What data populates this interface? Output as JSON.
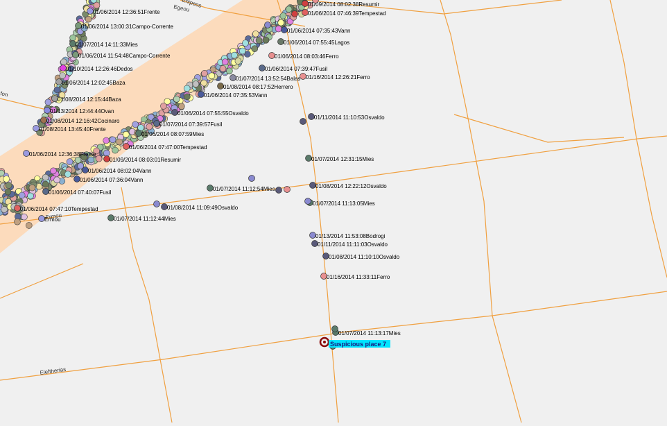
{
  "map": {
    "background": "#f0f0f0",
    "road_color": "#f0a040",
    "corridor_color": "#fcd9b8",
    "label_color": "#000000",
    "highlight_color": "#00e5ff",
    "roads": [
      {
        "name": "Xyfion",
        "label": "fon"
      },
      {
        "name": "Egeou",
        "label": "Egeou"
      },
      {
        "name": "Eleftherias",
        "label": "Eleftherias"
      },
      {
        "name": "Ermou",
        "label": "Ermou"
      },
      {
        "name": "Enipeos",
        "label": "Enipeos"
      }
    ],
    "events": [
      {
        "label": "01/09/2014 08:02:38Resumir",
        "color": "#d04040"
      },
      {
        "label": "01/06/2014 07:46:39Tempestad",
        "color": "#e06060"
      },
      {
        "label": "01/06/2014 07:35:43Vann",
        "color": "#4a5a9a"
      },
      {
        "label": "01/06/2014 07:55:45Lagos",
        "color": "#6a7a6a"
      },
      {
        "label": "01/06/2014 08:03:46Ferro",
        "color": "#e89090"
      },
      {
        "label": "01/06/2014 07:39:47Fusil",
        "color": "#5a6a8a"
      },
      {
        "label": "01/07/2014 13:52:54Balas",
        "color": "#8a8aa0"
      },
      {
        "label": "01/16/2014 12:26:21Ferro",
        "color": "#e89090"
      },
      {
        "label": "01/08/2014 08:17:52Herrero",
        "color": "#7a6a4a"
      },
      {
        "label": "01/06/2014 07:35:53Vann",
        "color": "#4a5a9a"
      },
      {
        "label": "01/11/2014 11:10:53Osvaldo",
        "color": "#5a5a7a"
      },
      {
        "label": "01/06/2014 07:55:55Osvaldo",
        "color": "#5a5a7a"
      },
      {
        "label": "01/07/2014 07:39:57Fusil",
        "color": "#5a6a8a"
      },
      {
        "label": "01/06/2014 08:07:59Mies",
        "color": "#5a7a6a"
      },
      {
        "label": "01/06/2014 07:47:00Tempestad",
        "color": "#e06060"
      },
      {
        "label": "01/09/2014 08:03:01Resumir",
        "color": "#d04040"
      },
      {
        "label": "01/07/2014 12:31:15Mies",
        "color": "#5a7a6a"
      },
      {
        "label": "01/06/2014 08:02:04Vann",
        "color": "#4a5a9a"
      },
      {
        "label": "01/06/2014 07:36:04Vann",
        "color": "#4a5a9a"
      },
      {
        "label": "01/06/2014 07:40:07Fusil",
        "color": "#5a6a8a"
      },
      {
        "label": "01/08/2014 12:22:12Osvaldo",
        "color": "#5a5a7a"
      },
      {
        "label": "01/07/2014 11:12:54Mies",
        "color": "#5a7a6a"
      },
      {
        "label": "01/07/2014 11:13:05Mies",
        "color": "#5a7a6a"
      },
      {
        "label": "01/08/2014 11:09:49Osvaldo",
        "color": "#5a5a7a"
      },
      {
        "label": "01/06/2014 07:47:10Tempestad",
        "color": "#e06060"
      },
      {
        "label": "01/07/2014 11:12:44Mies",
        "color": "#5a7a6a"
      },
      {
        "label": "01/13/2014 11:53:08Bodrogi",
        "color": "#8a8ad0"
      },
      {
        "label": "01/11/2014 11:11:03Osvaldo",
        "color": "#5a5a7a"
      },
      {
        "label": "01/08/2014 11:10:10Osvaldo",
        "color": "#5a5a7a"
      },
      {
        "label": "01/16/2014 11:33:11Ferro",
        "color": "#e89090"
      },
      {
        "label": "01/07/2014 11:13:17Mies",
        "color": "#5a7a6a"
      },
      {
        "label": "01/06/2014 12:36:51Frente",
        "color": "#9a9ae0"
      },
      {
        "label": "01/06/2014 13:00:31Campo-Corrente",
        "color": "#7a9a7a"
      },
      {
        "label": "01/07/2014 14:11:33Mies",
        "color": "#5a7a6a"
      },
      {
        "label": "01/06/2014 11:54:48Campo-Corrente",
        "color": "#7a9a7a"
      },
      {
        "label": "01/10/2014 12:26:46Dedos",
        "color": "#e040e0"
      },
      {
        "label": "01/06/2014 12:02:45Baza",
        "color": "#a0a0a0"
      },
      {
        "label": "01/08/2014 12:15:44Baza",
        "color": "#a0a0a0"
      },
      {
        "label": "01/13/2014 12:44:44Ovan",
        "color": "#8a8ae0"
      },
      {
        "label": "01/08/2014 12:16:42Cocinaro",
        "color": "#a07050"
      },
      {
        "label": "01/08/2014 13:45:40Frente",
        "color": "#9a9ae0"
      },
      {
        "label": "01/06/2014 12:36:38Frente",
        "color": "#9a9ae0"
      },
      {
        "label": "Ermou",
        "color": "#9a9ae0"
      }
    ],
    "place": {
      "label": "Suspicious place 7",
      "ring_color": "#8a0a0a"
    }
  }
}
